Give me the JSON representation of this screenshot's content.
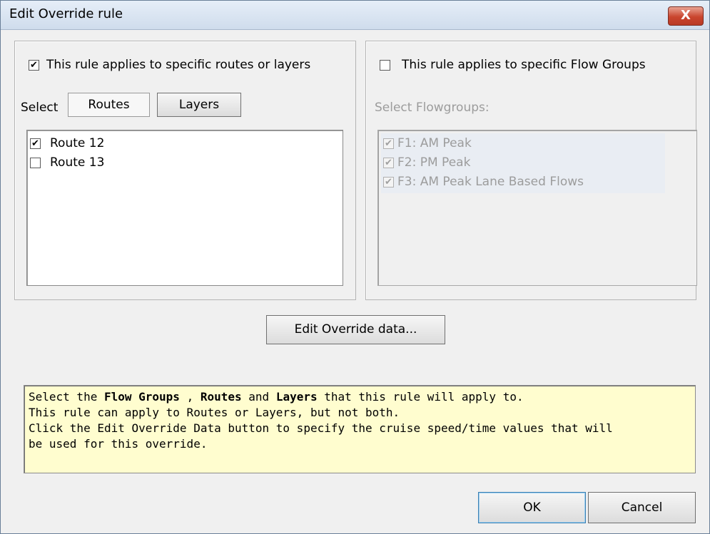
{
  "window": {
    "title": "Edit Override rule",
    "close_glyph": "X"
  },
  "routes_group": {
    "checkbox_label": "This rule applies to specific routes or layers",
    "checked": true,
    "select_label": "Select",
    "tab_routes": "Routes",
    "tab_layers": "Layers",
    "items": [
      {
        "label": "Route 12",
        "checked": true
      },
      {
        "label": "Route 13",
        "checked": false
      }
    ]
  },
  "flowgroups_group": {
    "checkbox_label": "This rule applies to specific Flow Groups",
    "checked": false,
    "select_label": "Select Flowgroups:",
    "items": [
      {
        "label": "F1: AM Peak",
        "checked": true
      },
      {
        "label": "F2: PM Peak",
        "checked": true
      },
      {
        "label": "F3: AM Peak Lane Based Flows",
        "checked": true
      }
    ]
  },
  "edit_override_button": "Edit Override data...",
  "info": {
    "line1_pre": "Select the ",
    "line1_b1": "Flow Groups",
    "line1_mid1": " , ",
    "line1_b2": "Routes",
    "line1_mid2": " and ",
    "line1_b3": "Layers",
    "line1_post": " that this rule will apply to.",
    "line2": "This rule can apply to Routes or Layers, but not both.",
    "line3": "Click the Edit Override Data button to specify the cruise speed/time values that will",
    "line4": "be used for this override."
  },
  "ok_button": "OK",
  "cancel_button": "Cancel",
  "check_glyph": "✔"
}
